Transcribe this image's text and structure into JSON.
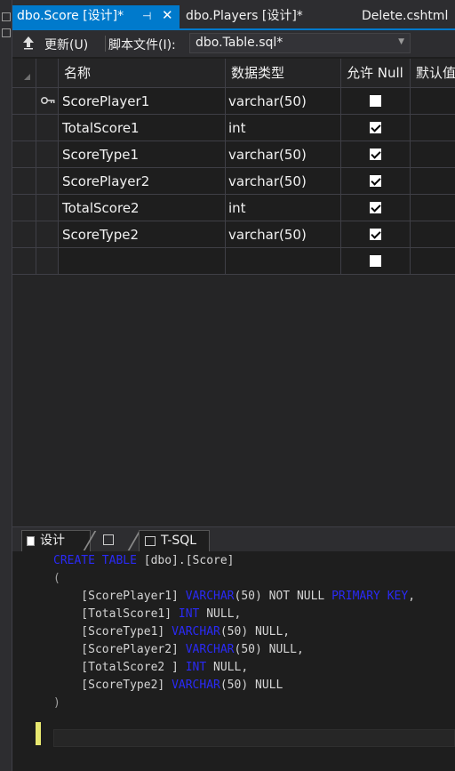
{
  "tabs": {
    "active": "dbo.Score [设计]*",
    "second": "dbo.Players [设计]*",
    "third": "Delete.cshtml",
    "pin_glyph": "⊣",
    "close_glyph": "✕"
  },
  "toolbar": {
    "update_label": "更新(U)",
    "script_file_label": "脚本文件(I):",
    "script_file_value": "dbo.Table.sql*"
  },
  "grid": {
    "headers": [
      "名称",
      "数据类型",
      "允许 Null",
      "默认值"
    ],
    "rows": [
      {
        "name": "ScorePlayer1",
        "type": "varchar(50)",
        "allow_null": false,
        "primary_key": true
      },
      {
        "name": "TotalScore1",
        "type": "int",
        "allow_null": true,
        "primary_key": false
      },
      {
        "name": "ScoreType1",
        "type": "varchar(50)",
        "allow_null": true,
        "primary_key": false
      },
      {
        "name": "ScorePlayer2",
        "type": "varchar(50)",
        "allow_null": true,
        "primary_key": false
      },
      {
        "name": "TotalScore2",
        "type": "int",
        "allow_null": true,
        "primary_key": false
      },
      {
        "name": "ScoreType2",
        "type": "varchar(50)",
        "allow_null": true,
        "primary_key": false
      },
      {
        "name": "",
        "type": "",
        "allow_null": false,
        "primary_key": false
      }
    ]
  },
  "bottom_tabs": {
    "design": "设计",
    "tsql": "T-SQL"
  },
  "code": {
    "l1_kw": "CREATE TABLE",
    "l1_rest": " [dbo].[Score]",
    "l2": "(",
    "l3_a": "    [ScorePlayer1] ",
    "l3_kw": "VARCHAR",
    "l3_b": "(50) NOT NULL ",
    "l3_kw2": "PRIMARY KEY",
    "l3_c": ",",
    "l4_a": "    [TotalScore1] ",
    "l4_kw": "INT",
    "l4_b": " NULL,",
    "l5_a": "    [ScoreType1] ",
    "l5_kw": "VARCHAR",
    "l5_b": "(50) NULL,",
    "l6_a": "    [ScorePlayer2] ",
    "l6_kw": "VARCHAR",
    "l6_b": "(50) NULL,",
    "l7_a": "    [TotalScore2 ] ",
    "l7_kw": "INT",
    "l7_b": " NULL,",
    "l8_a": "    [ScoreType2] ",
    "l8_kw": "VARCHAR",
    "l8_b": "(50) NULL",
    "l9": ")"
  },
  "colors": {
    "accent": "#007acc",
    "keyword": "#2a2af5",
    "background": "#1e1e1e"
  }
}
